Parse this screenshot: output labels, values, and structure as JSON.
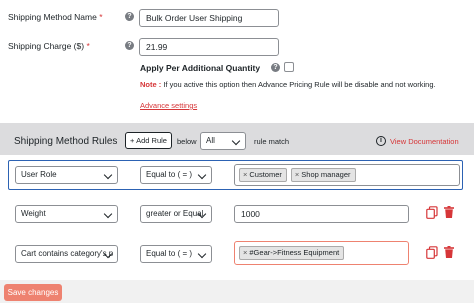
{
  "form": {
    "method_name_label": "Shipping Method Name",
    "method_name_req": "*",
    "method_name_value": "Bulk Order User Shipping",
    "charge_label": "Shipping Charge ($)",
    "charge_req": "*",
    "charge_value": "21.99",
    "additional_qty_label": "Apply Per Additional Quantity",
    "note_prefix": "Note :",
    "note_text": "If you active this option then Advance Pricing Rule will be disable and not working.",
    "advance_settings": "Advance settings",
    "help_glyph": "?"
  },
  "rules": {
    "title": "Shipping Method Rules",
    "add_rule": "+ Add Rule",
    "below": "below",
    "match_value": "All",
    "rule_match": "rule match",
    "view_doc": "View Documentation",
    "info_glyph": "i",
    "rows": [
      {
        "field": "User Role",
        "operator": "Equal to ( = )",
        "tags": [
          "Customer",
          "Shop manager"
        ],
        "value": null,
        "highlighted": true
      },
      {
        "field": "Weight",
        "operator": "greater or Equal",
        "tags": [],
        "value": "1000",
        "highlighted": false
      },
      {
        "field": "Cart contains category's p",
        "operator": "Equal to ( = )",
        "tags": [
          "#Gear->Fitness Equipment"
        ],
        "value": null,
        "highlighted": false
      }
    ]
  },
  "footer": {
    "save_label": "Save changes"
  },
  "colors": {
    "accent_red": "#d63638",
    "highlight_blue": "#2c62b3",
    "save_btn": "#ee8270"
  },
  "icons": {
    "copy": "copy-icon",
    "delete": "trash-icon",
    "info": "info-icon",
    "help": "help-icon",
    "remove_tag": "×"
  }
}
